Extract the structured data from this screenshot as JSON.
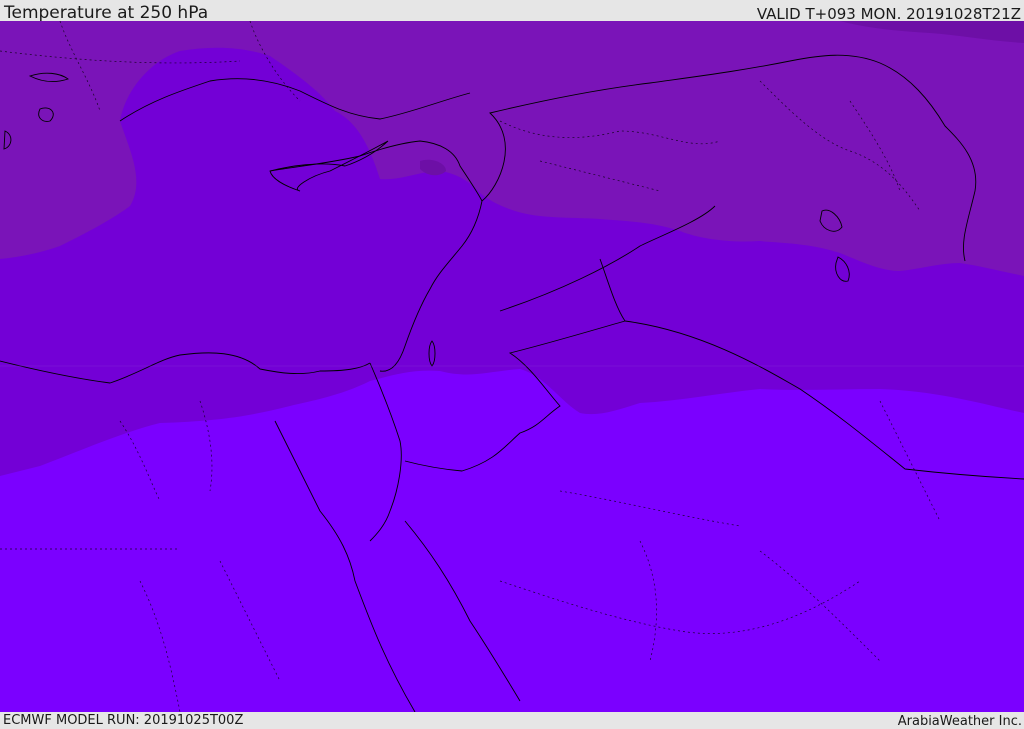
{
  "header": {
    "title": "Temperature at 250 hPa",
    "valid": "VALID T+093 MON. 20191028T21Z"
  },
  "footer": {
    "model_run": "ECMWF MODEL RUN: 20191025T00Z",
    "credit": "ArabiaWeather Inc."
  },
  "map": {
    "fill_colors": {
      "coldest": "#6d0fa6",
      "cold": "#7a14b8",
      "mid": "#7300d6",
      "warm": "#7b00ff"
    },
    "border_color": "#000000"
  }
}
